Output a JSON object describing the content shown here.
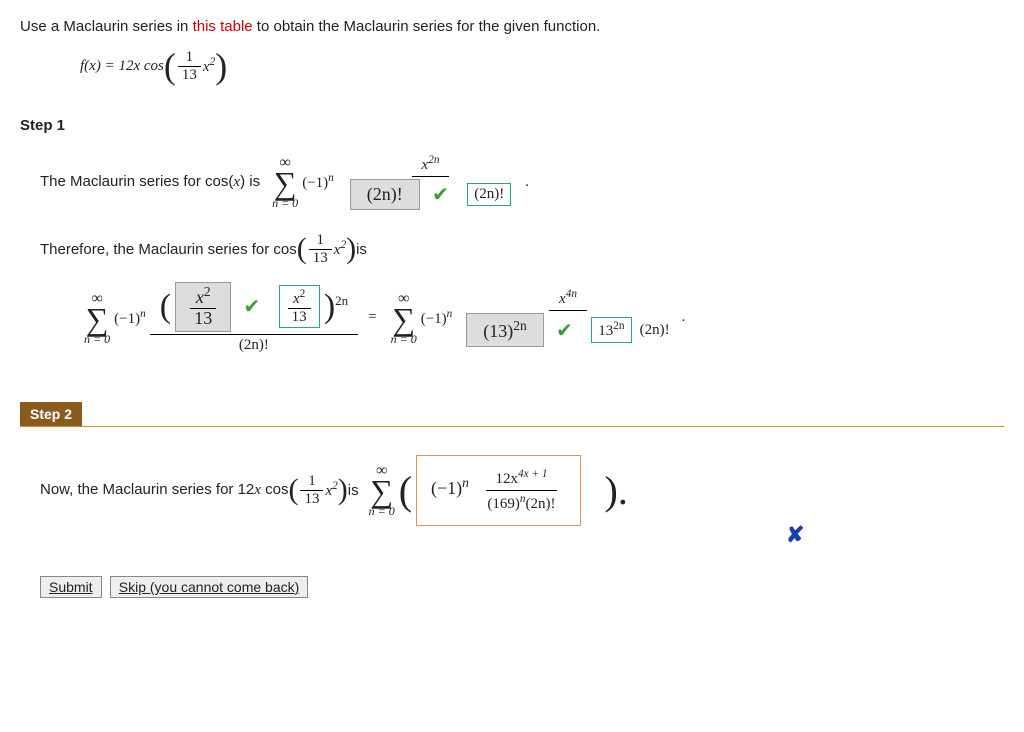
{
  "prompt": {
    "pre": "Use a Maclaurin series in ",
    "link": "this table",
    "post": " to obtain the Maclaurin series for the given function."
  },
  "func": {
    "lhs": "f(x) = 12x cos",
    "frac_num": "1",
    "frac_den": "13",
    "arg_tail": "x",
    "arg_exp": "2"
  },
  "step1": {
    "label": "Step 1",
    "line1_pre": "The Maclaurin series for cos(",
    "line1_var": "x",
    "line1_post": ") is",
    "sigma_top": "∞",
    "sigma_bot": "n = 0",
    "neg1n": "(−1)",
    "exp_n": "n",
    "ans1": "(2n)!",
    "num1_pre": "x",
    "num1_exp": "2n",
    "green1": "(2n)!",
    "line2_pre": "Therefore, the Maclaurin series for cos",
    "line2_mid_num": "1",
    "line2_mid_den": "13",
    "line2_x": "x",
    "line2_exp": "2",
    "line2_post": " is",
    "ans2_num": "x",
    "ans2_exp": "2",
    "ans2_den": "13",
    "green2_num": "x",
    "green2_exp": "2",
    "green2_den": "13",
    "two_n": "2n",
    "denom2": "(2n)!",
    "ans3_base": "(13)",
    "ans3_exp": "2n",
    "num3_pre": "x",
    "num3_exp": "4n",
    "green3": "13",
    "green3_exp": "2n",
    "tail3": "(2n)!"
  },
  "step2": {
    "label": "Step 2",
    "pre": "Now, the Maclaurin series for 12",
    "x": "x",
    "cos": " cos",
    "frac_num": "1",
    "frac_den": "13",
    "arg_x": "x",
    "arg_exp": "2",
    "is": " is",
    "sigma_top": "∞",
    "sigma_bot": "n = 0",
    "ans_neg1": "(−1)",
    "ans_n": "n",
    "ans_num_a": "12x",
    "ans_num_exp": "4x + 1",
    "ans_den_a": "(169)",
    "ans_den_exp": "n",
    "ans_den_b": "(2n)!",
    "close": ")."
  },
  "buttons": {
    "submit": "Submit",
    "skip": "Skip (you cannot come back)"
  }
}
